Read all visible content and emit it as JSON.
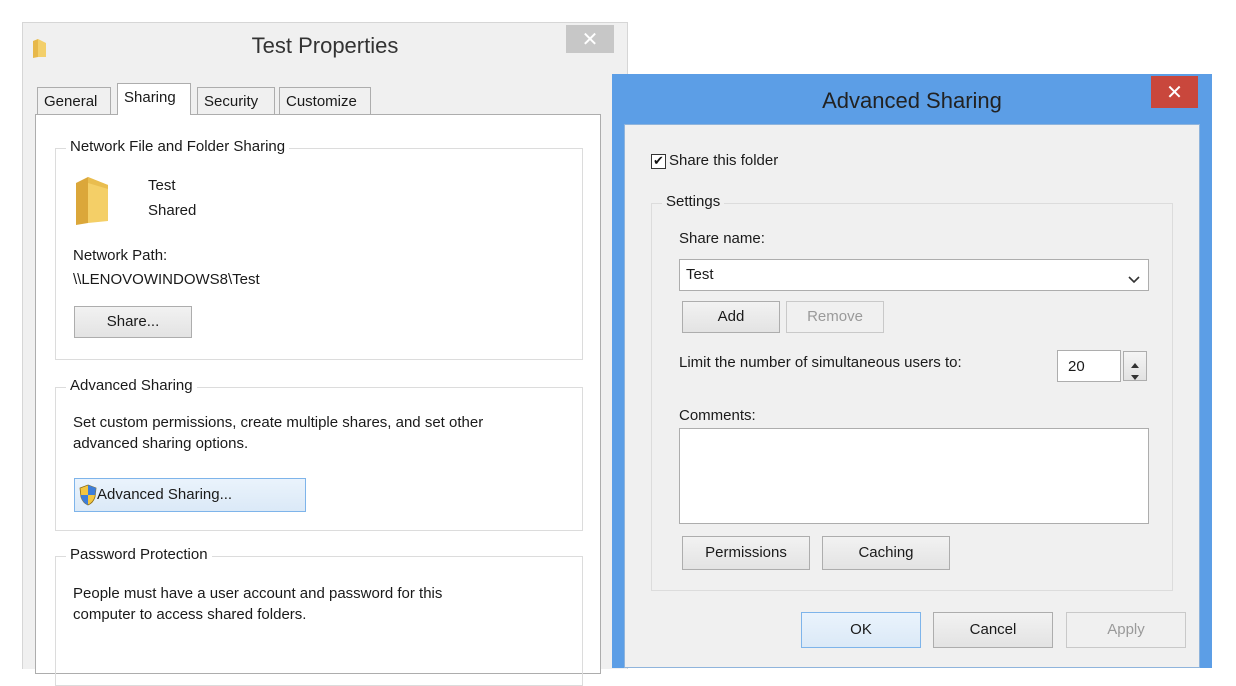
{
  "properties_window": {
    "title": "Test Properties",
    "close_glyph": "✕",
    "tabs": [
      {
        "label": "General",
        "active": false
      },
      {
        "label": "Sharing",
        "active": true
      },
      {
        "label": "Security",
        "active": false
      },
      {
        "label": "Customize",
        "active": false
      }
    ],
    "network_sharing": {
      "heading": "Network File and Folder Sharing",
      "folder_name": "Test",
      "folder_status": "Shared",
      "path_label": "Network Path:",
      "path_value": "\\\\LENOVOWINDOWS8\\Test",
      "share_button": "Share..."
    },
    "advanced_sharing": {
      "heading": "Advanced Sharing",
      "description_line1": "Set custom permissions, create multiple shares, and set other",
      "description_line2": "advanced sharing options.",
      "button": "Advanced Sharing..."
    },
    "password_protection": {
      "heading": "Password Protection",
      "description_line1": "People must have a user account and password for this",
      "description_line2": "computer to access shared folders."
    }
  },
  "advanced_dialog": {
    "title": "Advanced Sharing",
    "close_glyph": "✕",
    "share_checkbox_label": "Share this folder",
    "share_checkbox_checked": true,
    "check_glyph": "✔",
    "settings": {
      "heading": "Settings",
      "share_name_label": "Share name:",
      "share_name_value": "Test",
      "add_button": "Add",
      "remove_button": "Remove",
      "limit_label": "Limit the number of simultaneous users to:",
      "limit_value": "20",
      "comments_label": "Comments:",
      "comments_value": "",
      "permissions_button": "Permissions",
      "caching_button": "Caching"
    },
    "footer": {
      "ok_button": "OK",
      "cancel_button": "Cancel",
      "apply_button": "Apply"
    }
  },
  "icons": [
    "folder-icon",
    "folder-large-icon",
    "close-icon",
    "shield-icon",
    "check-icon",
    "chevron-down-icon",
    "spin-up-icon",
    "spin-down-icon"
  ],
  "colors": {
    "dialog_frame": "#5c9ee6",
    "close_button": "#c9473c",
    "window_bg": "#f0f0f0"
  }
}
